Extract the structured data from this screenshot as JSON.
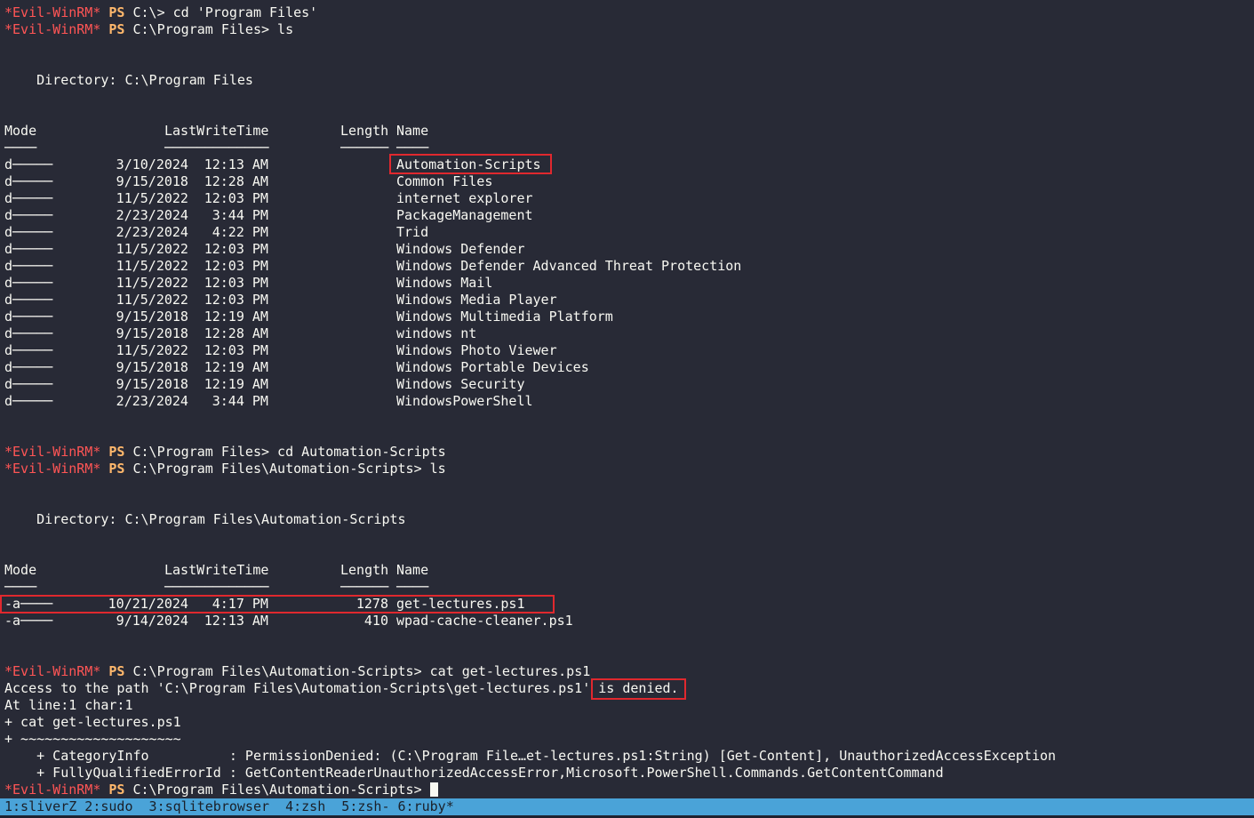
{
  "prompt": {
    "user": "*Evil-WinRM*",
    "shell": "PS"
  },
  "commands": [
    "C:\\> cd 'Program Files'",
    "C:\\Program Files> ls",
    "C:\\Program Files> cd Automation-Scripts",
    "C:\\Program Files\\Automation-Scripts> ls",
    "C:\\Program Files\\Automation-Scripts> cat get-lectures.ps1",
    "C:\\Program Files\\Automation-Scripts> "
  ],
  "listing1": {
    "directory_line": "    Directory: C:\\Program Files",
    "headers": {
      "mode": "Mode",
      "lastwrite": "LastWriteTime",
      "length": "Length",
      "name": "Name"
    },
    "underlines": {
      "mode": "────",
      "lastwrite": "─────────────",
      "length": "──────",
      "name": "────"
    },
    "rows": [
      {
        "mode": "d─────",
        "date": "3/10/2024",
        "time": "12:13 AM",
        "length": "",
        "name": "Automation-Scripts"
      },
      {
        "mode": "d─────",
        "date": "9/15/2018",
        "time": "12:28 AM",
        "length": "",
        "name": "Common Files"
      },
      {
        "mode": "d─────",
        "date": "11/5/2022",
        "time": "12:03 PM",
        "length": "",
        "name": "internet explorer"
      },
      {
        "mode": "d─────",
        "date": "2/23/2024",
        "time": "3:44 PM",
        "length": "",
        "name": "PackageManagement"
      },
      {
        "mode": "d─────",
        "date": "2/23/2024",
        "time": "4:22 PM",
        "length": "",
        "name": "Trid"
      },
      {
        "mode": "d─────",
        "date": "11/5/2022",
        "time": "12:03 PM",
        "length": "",
        "name": "Windows Defender"
      },
      {
        "mode": "d─────",
        "date": "11/5/2022",
        "time": "12:03 PM",
        "length": "",
        "name": "Windows Defender Advanced Threat Protection"
      },
      {
        "mode": "d─────",
        "date": "11/5/2022",
        "time": "12:03 PM",
        "length": "",
        "name": "Windows Mail"
      },
      {
        "mode": "d─────",
        "date": "11/5/2022",
        "time": "12:03 PM",
        "length": "",
        "name": "Windows Media Player"
      },
      {
        "mode": "d─────",
        "date": "9/15/2018",
        "time": "12:19 AM",
        "length": "",
        "name": "Windows Multimedia Platform"
      },
      {
        "mode": "d─────",
        "date": "9/15/2018",
        "time": "12:28 AM",
        "length": "",
        "name": "windows nt"
      },
      {
        "mode": "d─────",
        "date": "11/5/2022",
        "time": "12:03 PM",
        "length": "",
        "name": "Windows Photo Viewer"
      },
      {
        "mode": "d─────",
        "date": "9/15/2018",
        "time": "12:19 AM",
        "length": "",
        "name": "Windows Portable Devices"
      },
      {
        "mode": "d─────",
        "date": "9/15/2018",
        "time": "12:19 AM",
        "length": "",
        "name": "Windows Security"
      },
      {
        "mode": "d─────",
        "date": "2/23/2024",
        "time": "3:44 PM",
        "length": "",
        "name": "WindowsPowerShell"
      }
    ]
  },
  "listing2": {
    "directory_line": "    Directory: C:\\Program Files\\Automation-Scripts",
    "headers": {
      "mode": "Mode",
      "lastwrite": "LastWriteTime",
      "length": "Length",
      "name": "Name"
    },
    "underlines": {
      "mode": "────",
      "lastwrite": "─────────────",
      "length": "──────",
      "name": "────"
    },
    "rows": [
      {
        "mode": "-a────",
        "date": "10/21/2024",
        "time": "4:17 PM",
        "length": "1278",
        "name": "get-lectures.ps1"
      },
      {
        "mode": "-a────",
        "date": "9/14/2024",
        "time": "12:13 AM",
        "length": "410",
        "name": "wpad-cache-cleaner.ps1"
      }
    ]
  },
  "error": {
    "line1": "Access to the path 'C:\\Program Files\\Automation-Scripts\\get-lectures.ps1' is denied.",
    "line2": "At line:1 char:1",
    "line3": "+ cat get-lectures.ps1",
    "line4": "+ ~~~~~~~~~~~~~~~~~~~~",
    "line5": "    + CategoryInfo          : PermissionDenied: (C:\\Program File…et-lectures.ps1:String) [Get-Content], UnauthorizedAccessException",
    "line6": "    + FullyQualifiedErrorId : GetContentReaderUnauthorizedAccessError,Microsoft.PowerShell.Commands.GetContentCommand"
  },
  "statusbar": {
    "windows": "1:sliverZ 2:sudo  3:sqlitebrowser  4:zsh  5:zsh- 6:ruby*"
  },
  "colors": {
    "background": "#282a36",
    "prompt_user": "#ff5555",
    "prompt_ps": "#ffb86c",
    "highlight_box": "#e0282e",
    "statusbar": "#4aa3d8"
  }
}
